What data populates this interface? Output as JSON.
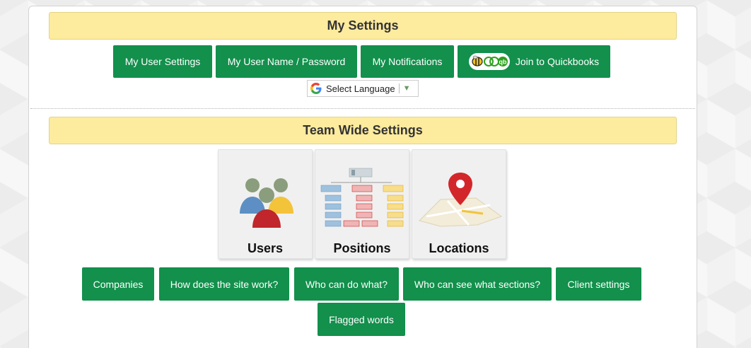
{
  "my_settings": {
    "title": "My Settings",
    "buttons": {
      "user_settings": "My User Settings",
      "user_name_password": "My User Name / Password",
      "notifications": "My Notifications",
      "join_quickbooks": "Join to Quickbooks"
    },
    "language": {
      "label": "Select Language",
      "icon": "google-g-icon"
    }
  },
  "team_settings": {
    "title": "Team Wide Settings",
    "tiles": {
      "users": "Users",
      "positions": "Positions",
      "locations": "Locations"
    },
    "buttons": {
      "companies": "Companies",
      "how_site_works": "How does the site work?",
      "who_can_do": "Who can do what?",
      "who_can_see": "Who can see what sections?",
      "client_settings": "Client settings",
      "flagged_words": "Flagged words"
    }
  },
  "colors": {
    "button_green": "#12904c",
    "header_yellow": "#fdeb9e"
  }
}
